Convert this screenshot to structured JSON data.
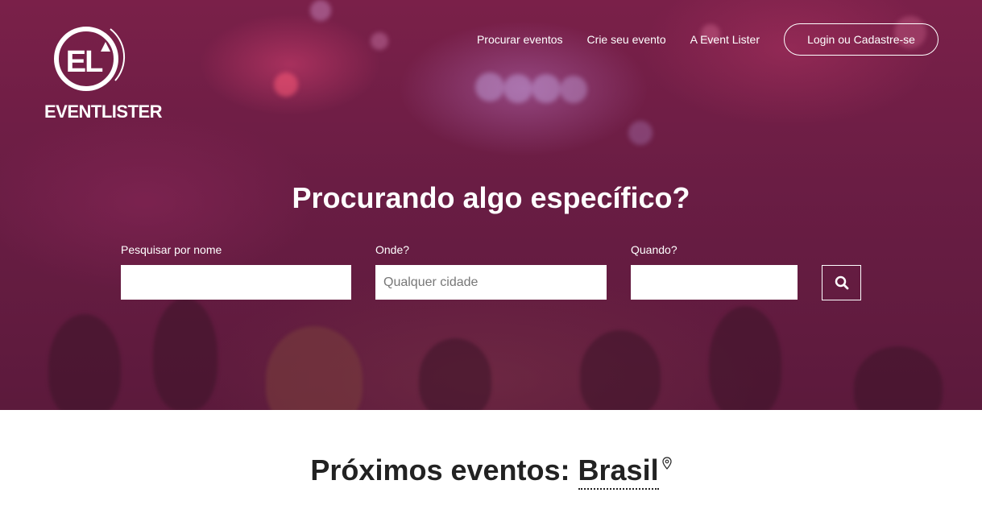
{
  "brand": {
    "logo_text": "EVENTLISTER",
    "mark_text": "EL"
  },
  "nav": {
    "items": [
      "Procurar eventos",
      "Crie seu evento",
      "A Event Lister"
    ],
    "login_label": "Login ou Cadastre-se"
  },
  "hero": {
    "title": "Procurando algo específico?",
    "name_label": "Pesquisar por nome",
    "name_value": "",
    "where_label": "Onde?",
    "where_placeholder": "Qualquer cidade",
    "when_label": "Quando?",
    "when_value": "",
    "search_icon": "search-icon"
  },
  "upcoming": {
    "prefix": "Próximos eventos:",
    "location": "Brasil",
    "location_icon": "map-pin-icon"
  },
  "colors": {
    "hero_tint": "#6a1d44",
    "text": "#ffffff",
    "heading_dark": "#222222"
  }
}
